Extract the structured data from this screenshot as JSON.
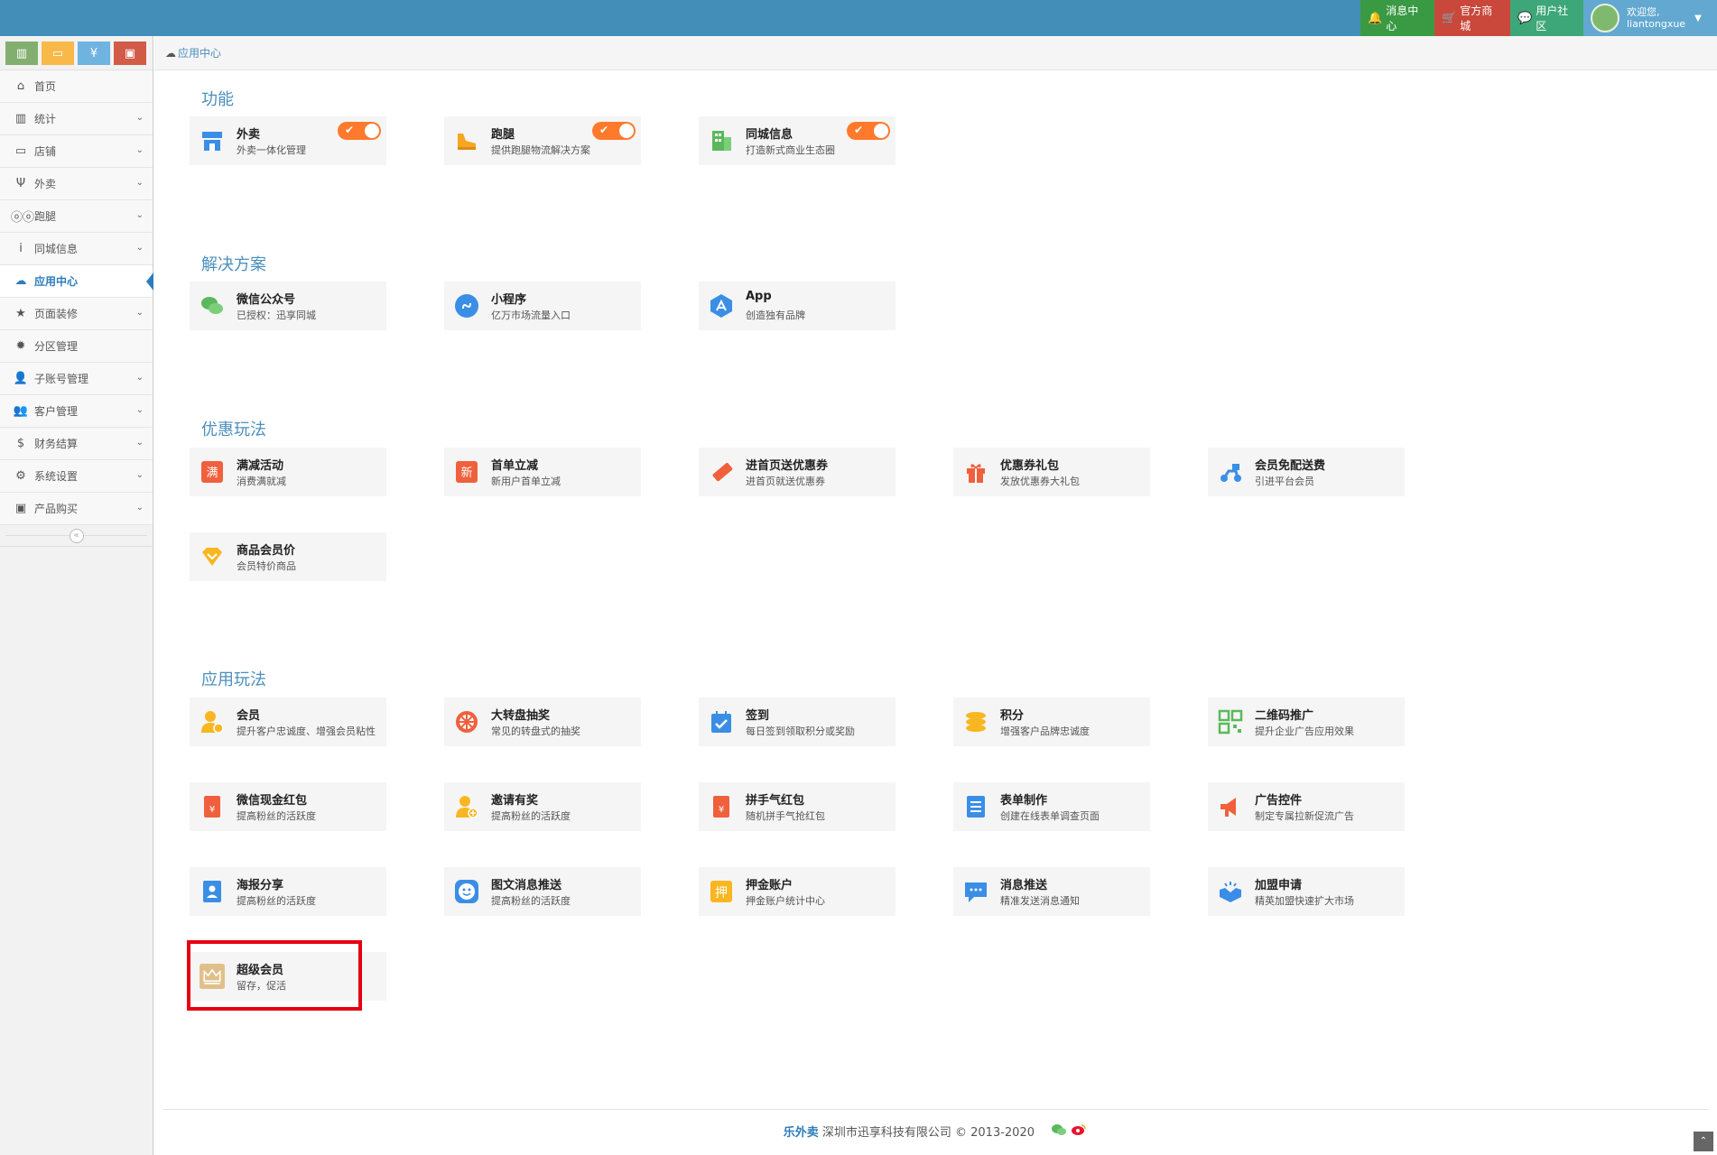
{
  "header": {
    "msg_center": "消息中心",
    "official_mall": "官方商城",
    "user_community": "用户社区",
    "welcome": "欢迎您,",
    "username": "liantongxue"
  },
  "sidebar": {
    "items": [
      {
        "label": "首页",
        "icon": "home-icon"
      },
      {
        "label": "统计",
        "icon": "bar-chart-icon"
      },
      {
        "label": "店铺",
        "icon": "desktop-icon"
      },
      {
        "label": "外卖",
        "icon": "cutlery-icon"
      },
      {
        "label": "跑腿",
        "icon": "bicycle-icon"
      },
      {
        "label": "同城信息",
        "icon": "info-icon"
      },
      {
        "label": "应用中心",
        "icon": "cloud-icon"
      },
      {
        "label": "页面装修",
        "icon": "star-icon"
      },
      {
        "label": "分区管理",
        "icon": "gear-icon"
      },
      {
        "label": "子账号管理",
        "icon": "user-icon"
      },
      {
        "label": "客户管理",
        "icon": "users-icon"
      },
      {
        "label": "财务结算",
        "icon": "dollar-icon"
      },
      {
        "label": "系统设置",
        "icon": "cog-icon"
      },
      {
        "label": "产品购买",
        "icon": "briefcase-icon"
      }
    ]
  },
  "breadcrumb": {
    "current": "应用中心"
  },
  "sections": {
    "functions": "功能",
    "solutions": "解决方案",
    "promotions": "优惠玩法",
    "apps": "应用玩法"
  },
  "functions": [
    {
      "title": "外卖",
      "desc": "外卖一体化管理"
    },
    {
      "title": "跑腿",
      "desc": "提供跑腿物流解决方案"
    },
    {
      "title": "同城信息",
      "desc": "打造新式商业生态圈"
    }
  ],
  "solutions": [
    {
      "title": "微信公众号",
      "desc": "已授权：迅享同城"
    },
    {
      "title": "小程序",
      "desc": "亿万市场流量入口"
    },
    {
      "title": "App",
      "desc": "创造独有品牌"
    }
  ],
  "promotions": [
    {
      "title": "满减活动",
      "desc": "消费满就减"
    },
    {
      "title": "首单立减",
      "desc": "新用户首单立减"
    },
    {
      "title": "进首页送优惠券",
      "desc": "进首页就送优惠券"
    },
    {
      "title": "优惠券礼包",
      "desc": "发放优惠券大礼包"
    },
    {
      "title": "会员免配送费",
      "desc": "引进平台会员"
    },
    {
      "title": "商品会员价",
      "desc": "会员特价商品"
    }
  ],
  "apps": [
    {
      "title": "会员",
      "desc": "提升客户忠诚度、增强会员粘性"
    },
    {
      "title": "大转盘抽奖",
      "desc": "常见的转盘式的抽奖"
    },
    {
      "title": "签到",
      "desc": "每日签到领取积分或奖励"
    },
    {
      "title": "积分",
      "desc": "增强客户品牌忠诚度"
    },
    {
      "title": "二维码推广",
      "desc": "提升企业广告应用效果"
    },
    {
      "title": "微信现金红包",
      "desc": "提高粉丝的活跃度"
    },
    {
      "title": "邀请有奖",
      "desc": "提高粉丝的活跃度"
    },
    {
      "title": "拼手气红包",
      "desc": "随机拼手气抢红包"
    },
    {
      "title": "表单制作",
      "desc": "创建在线表单调查页面"
    },
    {
      "title": "广告控件",
      "desc": "制定专属拉新促流广告"
    },
    {
      "title": "海报分享",
      "desc": "提高粉丝的活跃度"
    },
    {
      "title": "图文消息推送",
      "desc": "提高粉丝的活跃度"
    },
    {
      "title": "押金账户",
      "desc": "押金账户统计中心"
    },
    {
      "title": "消息推送",
      "desc": "精准发送消息通知"
    },
    {
      "title": "加盟申请",
      "desc": "精英加盟快速扩大市场"
    },
    {
      "title": "超级会员",
      "desc": "留存，促活"
    }
  ],
  "footer": {
    "brand": "乐外卖",
    "company": "深圳市迅享科技有限公司 © 2013-2020"
  }
}
